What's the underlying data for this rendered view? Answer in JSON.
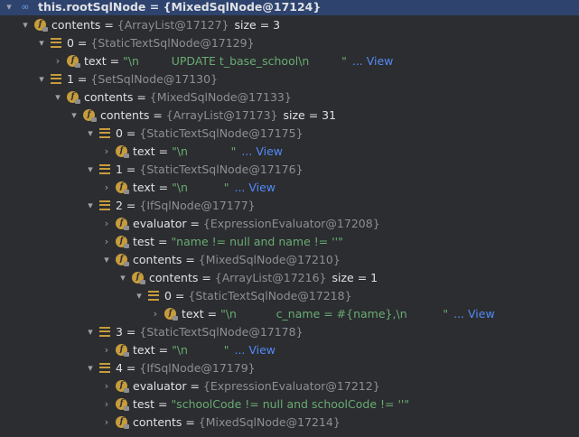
{
  "rows": [
    {
      "indent": 0,
      "chev": "▾",
      "icon": "oo-icon",
      "name": "this.rootSqlNode",
      "type": "{MixedSqlNode@17124}",
      "selected": true
    },
    {
      "indent": 1,
      "chev": "▾",
      "icon": "field-icon",
      "name": "contents",
      "type": "{ArrayList@17127}",
      "size": "size = 3"
    },
    {
      "indent": 2,
      "chev": "▾",
      "icon": "list-icon",
      "name": "0",
      "type": "{StaticTextSqlNode@17129}"
    },
    {
      "indent": 3,
      "chev": "›",
      "icon": "field-icon",
      "name": "text",
      "str": "\"\\n         UPDATE t_base_school\\n         \"",
      "view": "... View"
    },
    {
      "indent": 2,
      "chev": "▾",
      "icon": "list-icon",
      "name": "1",
      "type": "{SetSqlNode@17130}"
    },
    {
      "indent": 3,
      "chev": "▾",
      "icon": "field-icon",
      "name": "contents",
      "type": "{MixedSqlNode@17133}"
    },
    {
      "indent": 4,
      "chev": "▾",
      "icon": "field-icon",
      "name": "contents",
      "type": "{ArrayList@17173}",
      "size": "size = 31"
    },
    {
      "indent": 5,
      "chev": "▾",
      "icon": "list-icon",
      "name": "0",
      "type": "{StaticTextSqlNode@17175}"
    },
    {
      "indent": 6,
      "chev": "›",
      "icon": "field-icon",
      "name": "text",
      "str": "\"\\n            \"",
      "view": "... View"
    },
    {
      "indent": 5,
      "chev": "▾",
      "icon": "list-icon",
      "name": "1",
      "type": "{StaticTextSqlNode@17176}"
    },
    {
      "indent": 6,
      "chev": "›",
      "icon": "field-icon",
      "name": "text",
      "str": "\"\\n          \"",
      "view": "... View"
    },
    {
      "indent": 5,
      "chev": "▾",
      "icon": "list-icon",
      "name": "2",
      "type": "{IfSqlNode@17177}"
    },
    {
      "indent": 6,
      "chev": "›",
      "icon": "field-icon",
      "name": "evaluator",
      "type": "{ExpressionEvaluator@17208}"
    },
    {
      "indent": 6,
      "chev": "›",
      "icon": "field-icon",
      "name": "test",
      "str": "\"name != null and name != ''\""
    },
    {
      "indent": 6,
      "chev": "▾",
      "icon": "field-icon",
      "name": "contents",
      "type": "{MixedSqlNode@17210}"
    },
    {
      "indent": 7,
      "chev": "▾",
      "icon": "field-icon",
      "name": "contents",
      "type": "{ArrayList@17216}",
      "size": "size = 1"
    },
    {
      "indent": 8,
      "chev": "▾",
      "icon": "list-icon",
      "name": "0",
      "type": "{StaticTextSqlNode@17218}"
    },
    {
      "indent": 9,
      "chev": "›",
      "icon": "field-icon",
      "name": "text",
      "str": "\"\\n           c_name = #{name},\\n          \"",
      "view": "... View"
    },
    {
      "indent": 5,
      "chev": "▾",
      "icon": "list-icon",
      "name": "3",
      "type": "{StaticTextSqlNode@17178}"
    },
    {
      "indent": 6,
      "chev": "›",
      "icon": "field-icon",
      "name": "text",
      "str": "\"\\n          \"",
      "view": "... View"
    },
    {
      "indent": 5,
      "chev": "▾",
      "icon": "list-icon",
      "name": "4",
      "type": "{IfSqlNode@17179}"
    },
    {
      "indent": 6,
      "chev": "›",
      "icon": "field-icon",
      "name": "evaluator",
      "type": "{ExpressionEvaluator@17212}"
    },
    {
      "indent": 6,
      "chev": "›",
      "icon": "field-icon",
      "name": "test",
      "str": "\"schoolCode != null and schoolCode != ''\""
    },
    {
      "indent": 6,
      "chev": "›",
      "icon": "field-icon",
      "name": "contents",
      "type": "{MixedSqlNode@17214}"
    }
  ],
  "colors": {
    "background": "#2b2d30",
    "selection": "#2e436e",
    "string": "#6aab73",
    "escape": "#cf8e6d",
    "link": "#548af7",
    "type": "#8c8f94",
    "icon": "#c79c3d"
  }
}
